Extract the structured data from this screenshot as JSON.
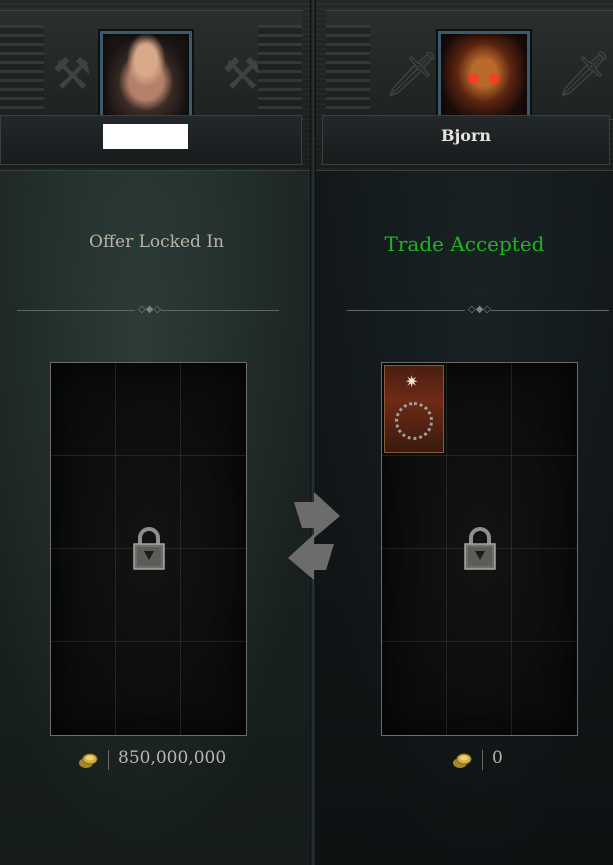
{
  "left": {
    "player_name": "",
    "status": "Offer Locked In",
    "gold": "850,000,000",
    "offer_locked": true
  },
  "right": {
    "player_name": "Bjorn",
    "status": "Trade Accepted",
    "gold": "0",
    "offer_locked": true,
    "items": [
      {
        "slot": 1,
        "icon": "thorn-crown-item-icon",
        "rarity_color": "#6e2a14"
      }
    ]
  },
  "colors": {
    "accepted": "#22b322",
    "status_text": "#b7b3a6",
    "text_light": "#e6e4de"
  }
}
